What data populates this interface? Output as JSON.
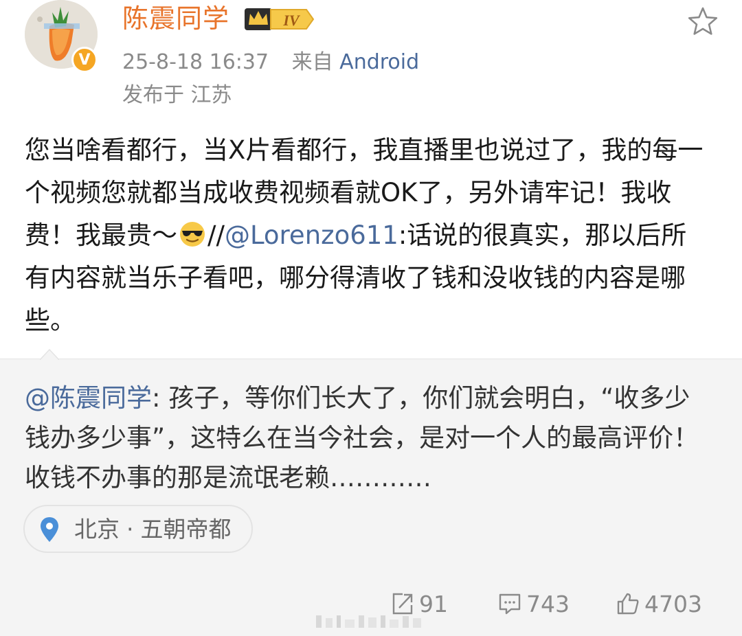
{
  "post": {
    "username": "陈震同学",
    "level": "IV",
    "verified_badge": "V",
    "time": "25-8-18 16:37",
    "source_prefix": "来自",
    "source": "Android",
    "location_line": "发布于 江苏",
    "text_part1": "您当啥看都行，当X片看都行，我直播里也说过了，我的每一个视频您就都当成收费视频看就OK了，另外请牢记！我收费！我最贵～",
    "emoji_name": "cool-sunglasses-emoji",
    "text_part2": "//",
    "mention": "@Lorenzo611",
    "text_part3": ":话说的很真实，那以后所有内容就当乐子看吧，哪分得清收了钱和没收钱的内容是哪些。"
  },
  "repost": {
    "mention": "@陈震同学",
    "text": ": 孩子，等你们长大了，你们就会明白，“收多少钱办多少事”，这特么在当今社会，是对一个人的最高评价！收钱不办事的那是流氓老赖…………",
    "location_city": "北京",
    "location_sep": "·",
    "location_name": "五朝帝都"
  },
  "actions": {
    "reposts": "91",
    "comments": "743",
    "likes": "4703"
  },
  "colors": {
    "username": "#e8742b",
    "link": "#4a6a9b",
    "meta": "#8a8a8a",
    "repost_bg": "#f4f4f4",
    "pin": "#4a8fd8"
  }
}
